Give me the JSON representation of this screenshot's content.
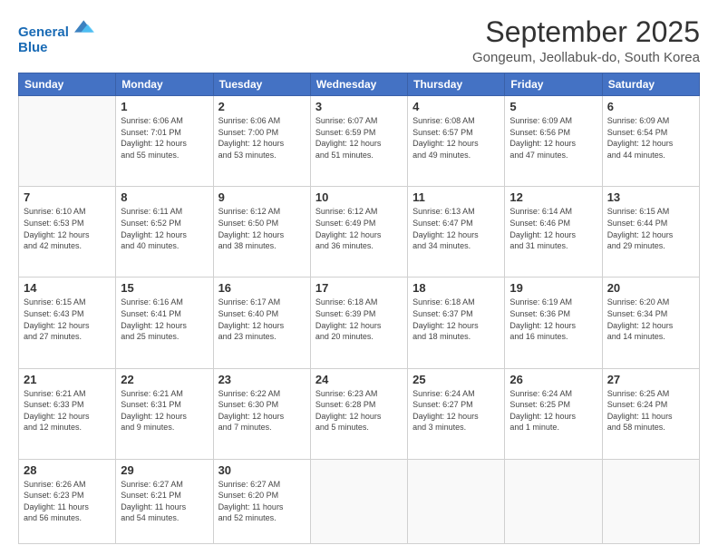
{
  "header": {
    "logo_line1": "General",
    "logo_line2": "Blue",
    "month_title": "September 2025",
    "location": "Gongeum, Jeollabuk-do, South Korea"
  },
  "days_of_week": [
    "Sunday",
    "Monday",
    "Tuesday",
    "Wednesday",
    "Thursday",
    "Friday",
    "Saturday"
  ],
  "weeks": [
    [
      {
        "day": "",
        "info": ""
      },
      {
        "day": "1",
        "info": "Sunrise: 6:06 AM\nSunset: 7:01 PM\nDaylight: 12 hours\nand 55 minutes."
      },
      {
        "day": "2",
        "info": "Sunrise: 6:06 AM\nSunset: 7:00 PM\nDaylight: 12 hours\nand 53 minutes."
      },
      {
        "day": "3",
        "info": "Sunrise: 6:07 AM\nSunset: 6:59 PM\nDaylight: 12 hours\nand 51 minutes."
      },
      {
        "day": "4",
        "info": "Sunrise: 6:08 AM\nSunset: 6:57 PM\nDaylight: 12 hours\nand 49 minutes."
      },
      {
        "day": "5",
        "info": "Sunrise: 6:09 AM\nSunset: 6:56 PM\nDaylight: 12 hours\nand 47 minutes."
      },
      {
        "day": "6",
        "info": "Sunrise: 6:09 AM\nSunset: 6:54 PM\nDaylight: 12 hours\nand 44 minutes."
      }
    ],
    [
      {
        "day": "7",
        "info": "Sunrise: 6:10 AM\nSunset: 6:53 PM\nDaylight: 12 hours\nand 42 minutes."
      },
      {
        "day": "8",
        "info": "Sunrise: 6:11 AM\nSunset: 6:52 PM\nDaylight: 12 hours\nand 40 minutes."
      },
      {
        "day": "9",
        "info": "Sunrise: 6:12 AM\nSunset: 6:50 PM\nDaylight: 12 hours\nand 38 minutes."
      },
      {
        "day": "10",
        "info": "Sunrise: 6:12 AM\nSunset: 6:49 PM\nDaylight: 12 hours\nand 36 minutes."
      },
      {
        "day": "11",
        "info": "Sunrise: 6:13 AM\nSunset: 6:47 PM\nDaylight: 12 hours\nand 34 minutes."
      },
      {
        "day": "12",
        "info": "Sunrise: 6:14 AM\nSunset: 6:46 PM\nDaylight: 12 hours\nand 31 minutes."
      },
      {
        "day": "13",
        "info": "Sunrise: 6:15 AM\nSunset: 6:44 PM\nDaylight: 12 hours\nand 29 minutes."
      }
    ],
    [
      {
        "day": "14",
        "info": "Sunrise: 6:15 AM\nSunset: 6:43 PM\nDaylight: 12 hours\nand 27 minutes."
      },
      {
        "day": "15",
        "info": "Sunrise: 6:16 AM\nSunset: 6:41 PM\nDaylight: 12 hours\nand 25 minutes."
      },
      {
        "day": "16",
        "info": "Sunrise: 6:17 AM\nSunset: 6:40 PM\nDaylight: 12 hours\nand 23 minutes."
      },
      {
        "day": "17",
        "info": "Sunrise: 6:18 AM\nSunset: 6:39 PM\nDaylight: 12 hours\nand 20 minutes."
      },
      {
        "day": "18",
        "info": "Sunrise: 6:18 AM\nSunset: 6:37 PM\nDaylight: 12 hours\nand 18 minutes."
      },
      {
        "day": "19",
        "info": "Sunrise: 6:19 AM\nSunset: 6:36 PM\nDaylight: 12 hours\nand 16 minutes."
      },
      {
        "day": "20",
        "info": "Sunrise: 6:20 AM\nSunset: 6:34 PM\nDaylight: 12 hours\nand 14 minutes."
      }
    ],
    [
      {
        "day": "21",
        "info": "Sunrise: 6:21 AM\nSunset: 6:33 PM\nDaylight: 12 hours\nand 12 minutes."
      },
      {
        "day": "22",
        "info": "Sunrise: 6:21 AM\nSunset: 6:31 PM\nDaylight: 12 hours\nand 9 minutes."
      },
      {
        "day": "23",
        "info": "Sunrise: 6:22 AM\nSunset: 6:30 PM\nDaylight: 12 hours\nand 7 minutes."
      },
      {
        "day": "24",
        "info": "Sunrise: 6:23 AM\nSunset: 6:28 PM\nDaylight: 12 hours\nand 5 minutes."
      },
      {
        "day": "25",
        "info": "Sunrise: 6:24 AM\nSunset: 6:27 PM\nDaylight: 12 hours\nand 3 minutes."
      },
      {
        "day": "26",
        "info": "Sunrise: 6:24 AM\nSunset: 6:25 PM\nDaylight: 12 hours\nand 1 minute."
      },
      {
        "day": "27",
        "info": "Sunrise: 6:25 AM\nSunset: 6:24 PM\nDaylight: 11 hours\nand 58 minutes."
      }
    ],
    [
      {
        "day": "28",
        "info": "Sunrise: 6:26 AM\nSunset: 6:23 PM\nDaylight: 11 hours\nand 56 minutes."
      },
      {
        "day": "29",
        "info": "Sunrise: 6:27 AM\nSunset: 6:21 PM\nDaylight: 11 hours\nand 54 minutes."
      },
      {
        "day": "30",
        "info": "Sunrise: 6:27 AM\nSunset: 6:20 PM\nDaylight: 11 hours\nand 52 minutes."
      },
      {
        "day": "",
        "info": ""
      },
      {
        "day": "",
        "info": ""
      },
      {
        "day": "",
        "info": ""
      },
      {
        "day": "",
        "info": ""
      }
    ]
  ]
}
